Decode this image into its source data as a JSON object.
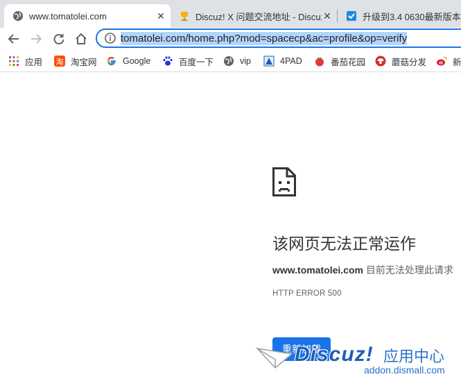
{
  "tabs": [
    {
      "title": "www.tomatolei.com",
      "icon": "globe-icon",
      "active": true,
      "close": "✕"
    },
    {
      "title": "Discuz! X 问题交流地址 - Discuz",
      "icon": "trophy-icon",
      "active": false,
      "close": "✕"
    },
    {
      "title": "升级到3.4 0630最新版本，",
      "icon": "blue-checkbox-icon",
      "active": false
    }
  ],
  "toolbar": {
    "back": "back-arrow-icon",
    "forward": "forward-arrow-icon",
    "reload": "reload-icon",
    "home": "home-icon",
    "url": "tomatolei.com/home.php?mod=spacecp&ac=profile&op=verify"
  },
  "bookmarks": [
    {
      "label": "应用",
      "icon": "apps-grid-icon"
    },
    {
      "label": "淘宝网",
      "icon": "taobao-icon"
    },
    {
      "label": "Google",
      "icon": "google-icon"
    },
    {
      "label": "百度一下",
      "icon": "baidu-paw-icon"
    },
    {
      "label": "vip",
      "icon": "globe-icon"
    },
    {
      "label": "4PAD",
      "icon": "4pad-icon"
    },
    {
      "label": "番茄花园",
      "icon": "tomato-icon"
    },
    {
      "label": "蘑菇分发",
      "icon": "mushroom-icon"
    },
    {
      "label": "新",
      "icon": "weibo-icon"
    }
  ],
  "error": {
    "icon": "sad-page-icon",
    "title": "该网页无法正常运作",
    "host": "www.tomatolei.com",
    "description": "目前无法处理此请求",
    "code": "HTTP ERROR 500",
    "reload_button": "重新加载"
  },
  "watermark": {
    "logo": "Discuz!",
    "cn": "应用中心",
    "url": "addon.dismall.com"
  },
  "colors": {
    "accent": "#1a73e8",
    "tabbar": "#dee1e6",
    "url_highlight": "#b3d4fc"
  }
}
